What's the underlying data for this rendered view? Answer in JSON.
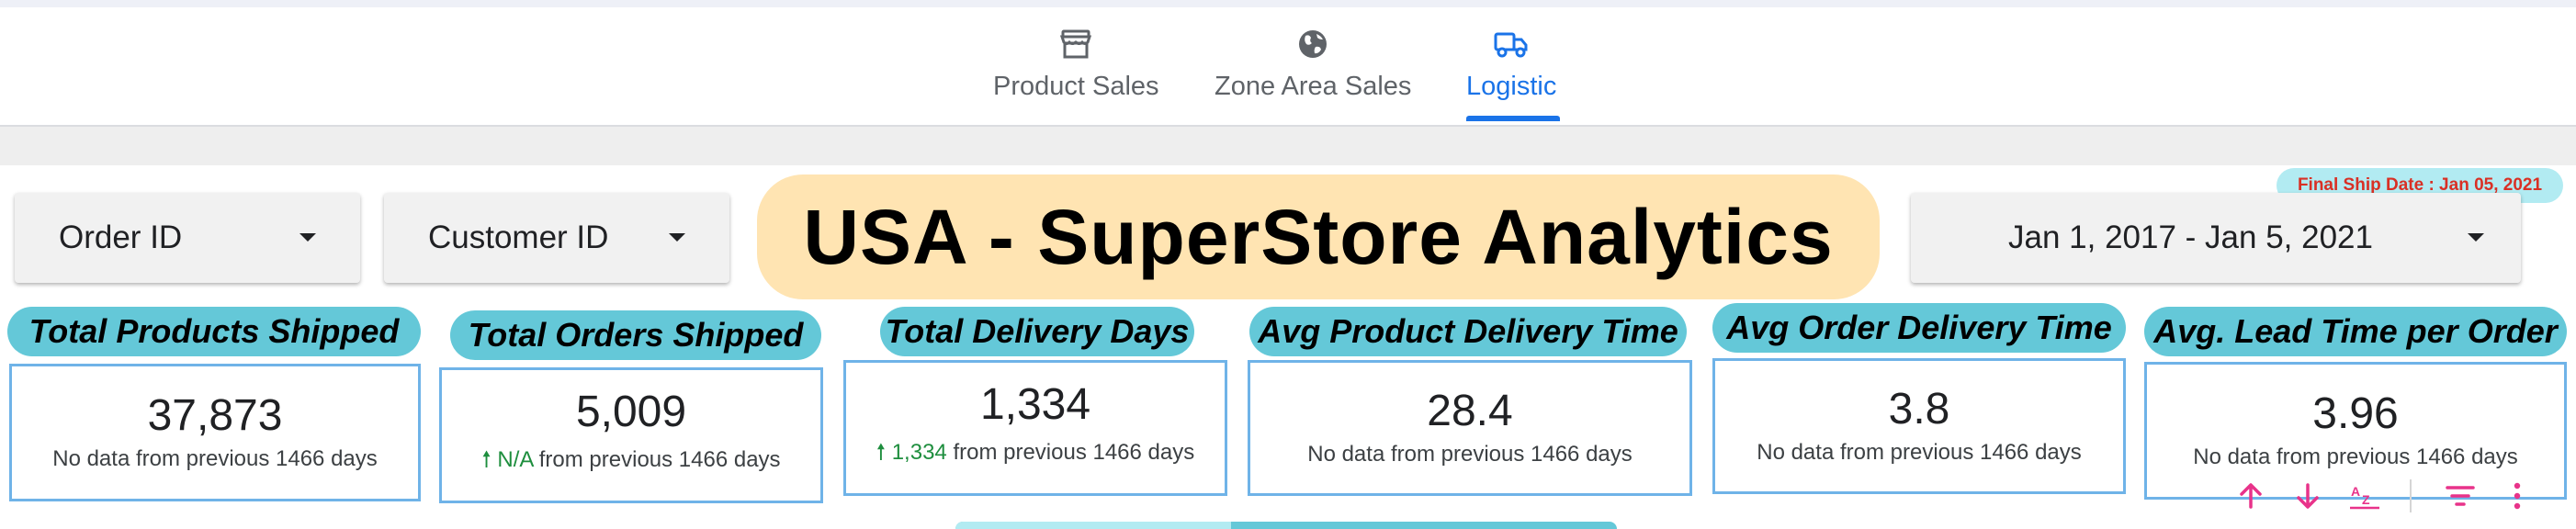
{
  "tabs": [
    {
      "label": "Product Sales",
      "icon": "storefront-icon",
      "active": false
    },
    {
      "label": "Zone Area Sales",
      "icon": "globe-icon",
      "active": false
    },
    {
      "label": "Logistic",
      "icon": "truck-icon",
      "active": true
    }
  ],
  "header": {
    "ship_date": "Final Ship Date : Jan 05, 2021",
    "title": "USA - SuperStore Analytics"
  },
  "filters": {
    "order_id": "Order ID",
    "customer_id": "Customer ID",
    "date_range": "Jan 1, 2017 - Jan 5, 2021"
  },
  "kpis": [
    {
      "title": "Total Products Shipped",
      "value": "37,873",
      "compare": "No data from previous 1466 days",
      "trend": ""
    },
    {
      "title": "Total Orders Shipped",
      "value": "5,009",
      "compare": "from previous 1466 days",
      "trend": "N/A"
    },
    {
      "title": "Total Delivery Days",
      "value": "1,334",
      "compare": "from previous 1466 days",
      "trend": "1,334"
    },
    {
      "title": "Avg Product Delivery Time",
      "value": "28.4",
      "compare": "No data from previous 1466 days",
      "trend": ""
    },
    {
      "title": "Avg Order Delivery Time",
      "value": "3.8",
      "compare": "No data from previous 1466 days",
      "trend": ""
    },
    {
      "title": "Avg. Lead Time per Order",
      "value": "3.96",
      "compare": "No data from previous 1466 days",
      "trend": ""
    }
  ],
  "toolbar_icons": [
    "sort-ascending-icon",
    "sort-descending-icon",
    "sort-az-icon",
    "filter-icon",
    "more-vert-icon"
  ],
  "colors": {
    "accent": "#1a73e8",
    "pill": "#64c8d8",
    "banner": "#ffe4b2",
    "card_border": "#6fb3e8",
    "trend_up": "#1e8e3e",
    "ship_date_text": "#d93025",
    "toolbar_icon": "#e8338a"
  }
}
